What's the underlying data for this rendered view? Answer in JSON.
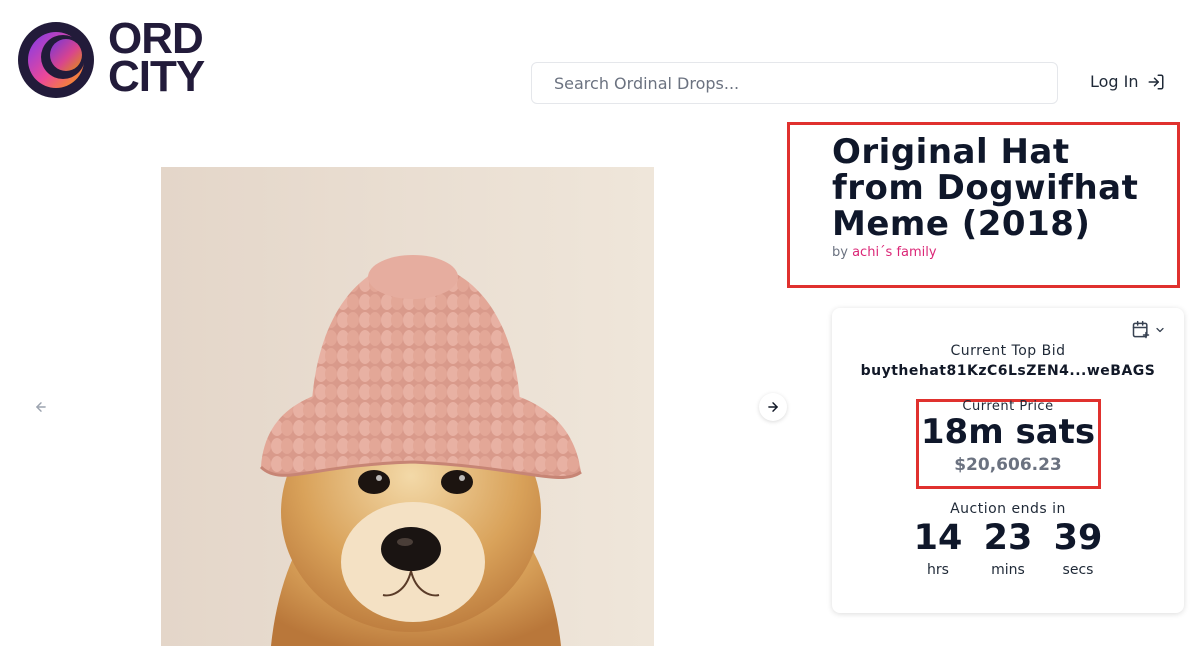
{
  "brand": {
    "logo_line1": "ORD",
    "logo_line2": "CITY"
  },
  "search": {
    "placeholder": "Search Ordinal Drops..."
  },
  "header": {
    "login_label": "Log In"
  },
  "item": {
    "title": "Original Hat from Dogwifhat Meme (2018)",
    "by_label": "by",
    "creator": "achi´s family"
  },
  "auction": {
    "top_bid_label": "Current Top Bid",
    "top_bid_address": "buythehat81KzC6LsZEN4...weBAGS",
    "price_label": "Current Price",
    "price_value": "18m sats",
    "price_usd": "$20,606.23",
    "ends_label": "Auction ends in",
    "countdown": [
      {
        "value": "14",
        "unit": "hrs"
      },
      {
        "value": "23",
        "unit": "mins"
      },
      {
        "value": "39",
        "unit": "secs"
      }
    ]
  },
  "colors": {
    "accent_pink": "#db2777",
    "highlight_red": "#e0312e",
    "logo_dark": "#221b3a"
  },
  "icons": [
    "logo-mark",
    "login-arrow-icon",
    "arrow-left-icon",
    "arrow-right-icon",
    "calendar-plus-icon",
    "chevron-down-icon"
  ]
}
